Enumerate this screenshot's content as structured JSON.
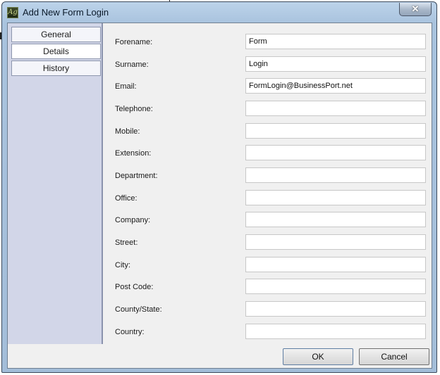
{
  "window": {
    "title": "Add New Form Login",
    "icon_text": "Ag",
    "close_glyph": "✕"
  },
  "sidebar": {
    "tabs": [
      {
        "label": "General",
        "active": false
      },
      {
        "label": "Details",
        "active": true
      },
      {
        "label": "History",
        "active": false
      }
    ]
  },
  "form": {
    "fields": [
      {
        "label": "Forename:",
        "value": "Form"
      },
      {
        "label": "Surname:",
        "value": "Login"
      },
      {
        "label": "Email:",
        "value": "FormLogin@BusinessPort.net"
      },
      {
        "label": "Telephone:",
        "value": ""
      },
      {
        "label": "Mobile:",
        "value": ""
      },
      {
        "label": "Extension:",
        "value": ""
      },
      {
        "label": "Department:",
        "value": ""
      },
      {
        "label": "Office:",
        "value": ""
      },
      {
        "label": "Company:",
        "value": ""
      },
      {
        "label": "Street:",
        "value": ""
      },
      {
        "label": "City:",
        "value": ""
      },
      {
        "label": "Post Code:",
        "value": ""
      },
      {
        "label": "County/State:",
        "value": ""
      },
      {
        "label": "Country:",
        "value": ""
      }
    ]
  },
  "footer": {
    "ok_label": "OK",
    "cancel_label": "Cancel"
  }
}
